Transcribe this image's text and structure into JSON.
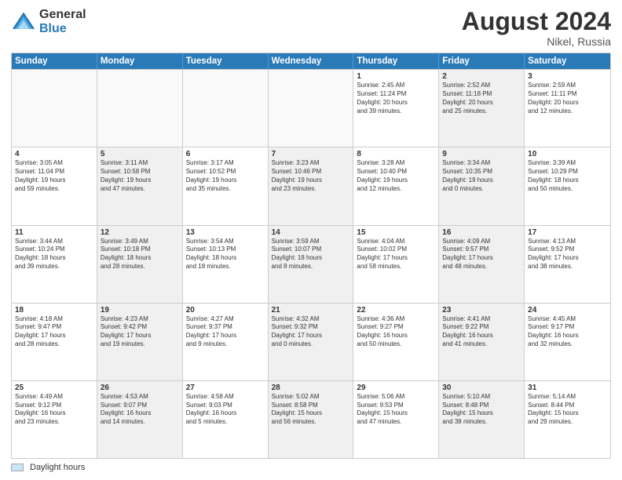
{
  "logo": {
    "general": "General",
    "blue": "Blue"
  },
  "title": "August 2024",
  "subtitle": "Nikel, Russia",
  "days_of_week": [
    "Sunday",
    "Monday",
    "Tuesday",
    "Wednesday",
    "Thursday",
    "Friday",
    "Saturday"
  ],
  "legend": "Daylight hours",
  "weeks": [
    [
      {
        "day": "",
        "info": "",
        "shaded": false,
        "empty": true
      },
      {
        "day": "",
        "info": "",
        "shaded": false,
        "empty": true
      },
      {
        "day": "",
        "info": "",
        "shaded": false,
        "empty": true
      },
      {
        "day": "",
        "info": "",
        "shaded": false,
        "empty": true
      },
      {
        "day": "1",
        "info": "Sunrise: 2:45 AM\nSunset: 11:24 PM\nDaylight: 20 hours\nand 39 minutes.",
        "shaded": false,
        "empty": false
      },
      {
        "day": "2",
        "info": "Sunrise: 2:52 AM\nSunset: 11:18 PM\nDaylight: 20 hours\nand 25 minutes.",
        "shaded": true,
        "empty": false
      },
      {
        "day": "3",
        "info": "Sunrise: 2:59 AM\nSunset: 11:11 PM\nDaylight: 20 hours\nand 12 minutes.",
        "shaded": false,
        "empty": false
      }
    ],
    [
      {
        "day": "4",
        "info": "Sunrise: 3:05 AM\nSunset: 11:04 PM\nDaylight: 19 hours\nand 59 minutes.",
        "shaded": false,
        "empty": false
      },
      {
        "day": "5",
        "info": "Sunrise: 3:11 AM\nSunset: 10:58 PM\nDaylight: 19 hours\nand 47 minutes.",
        "shaded": true,
        "empty": false
      },
      {
        "day": "6",
        "info": "Sunrise: 3:17 AM\nSunset: 10:52 PM\nDaylight: 19 hours\nand 35 minutes.",
        "shaded": false,
        "empty": false
      },
      {
        "day": "7",
        "info": "Sunrise: 3:23 AM\nSunset: 10:46 PM\nDaylight: 19 hours\nand 23 minutes.",
        "shaded": true,
        "empty": false
      },
      {
        "day": "8",
        "info": "Sunrise: 3:28 AM\nSunset: 10:40 PM\nDaylight: 19 hours\nand 12 minutes.",
        "shaded": false,
        "empty": false
      },
      {
        "day": "9",
        "info": "Sunrise: 3:34 AM\nSunset: 10:35 PM\nDaylight: 19 hours\nand 0 minutes.",
        "shaded": true,
        "empty": false
      },
      {
        "day": "10",
        "info": "Sunrise: 3:39 AM\nSunset: 10:29 PM\nDaylight: 18 hours\nand 50 minutes.",
        "shaded": false,
        "empty": false
      }
    ],
    [
      {
        "day": "11",
        "info": "Sunrise: 3:44 AM\nSunset: 10:24 PM\nDaylight: 18 hours\nand 39 minutes.",
        "shaded": false,
        "empty": false
      },
      {
        "day": "12",
        "info": "Sunrise: 3:49 AM\nSunset: 10:18 PM\nDaylight: 18 hours\nand 28 minutes.",
        "shaded": true,
        "empty": false
      },
      {
        "day": "13",
        "info": "Sunrise: 3:54 AM\nSunset: 10:13 PM\nDaylight: 18 hours\nand 18 minutes.",
        "shaded": false,
        "empty": false
      },
      {
        "day": "14",
        "info": "Sunrise: 3:59 AM\nSunset: 10:07 PM\nDaylight: 18 hours\nand 8 minutes.",
        "shaded": true,
        "empty": false
      },
      {
        "day": "15",
        "info": "Sunrise: 4:04 AM\nSunset: 10:02 PM\nDaylight: 17 hours\nand 58 minutes.",
        "shaded": false,
        "empty": false
      },
      {
        "day": "16",
        "info": "Sunrise: 4:09 AM\nSunset: 9:57 PM\nDaylight: 17 hours\nand 48 minutes.",
        "shaded": true,
        "empty": false
      },
      {
        "day": "17",
        "info": "Sunrise: 4:13 AM\nSunset: 9:52 PM\nDaylight: 17 hours\nand 38 minutes.",
        "shaded": false,
        "empty": false
      }
    ],
    [
      {
        "day": "18",
        "info": "Sunrise: 4:18 AM\nSunset: 9:47 PM\nDaylight: 17 hours\nand 28 minutes.",
        "shaded": false,
        "empty": false
      },
      {
        "day": "19",
        "info": "Sunrise: 4:23 AM\nSunset: 9:42 PM\nDaylight: 17 hours\nand 19 minutes.",
        "shaded": true,
        "empty": false
      },
      {
        "day": "20",
        "info": "Sunrise: 4:27 AM\nSunset: 9:37 PM\nDaylight: 17 hours\nand 9 minutes.",
        "shaded": false,
        "empty": false
      },
      {
        "day": "21",
        "info": "Sunrise: 4:32 AM\nSunset: 9:32 PM\nDaylight: 17 hours\nand 0 minutes.",
        "shaded": true,
        "empty": false
      },
      {
        "day": "22",
        "info": "Sunrise: 4:36 AM\nSunset: 9:27 PM\nDaylight: 16 hours\nand 50 minutes.",
        "shaded": false,
        "empty": false
      },
      {
        "day": "23",
        "info": "Sunrise: 4:41 AM\nSunset: 9:22 PM\nDaylight: 16 hours\nand 41 minutes.",
        "shaded": true,
        "empty": false
      },
      {
        "day": "24",
        "info": "Sunrise: 4:45 AM\nSunset: 9:17 PM\nDaylight: 16 hours\nand 32 minutes.",
        "shaded": false,
        "empty": false
      }
    ],
    [
      {
        "day": "25",
        "info": "Sunrise: 4:49 AM\nSunset: 9:12 PM\nDaylight: 16 hours\nand 23 minutes.",
        "shaded": false,
        "empty": false
      },
      {
        "day": "26",
        "info": "Sunrise: 4:53 AM\nSunset: 9:07 PM\nDaylight: 16 hours\nand 14 minutes.",
        "shaded": true,
        "empty": false
      },
      {
        "day": "27",
        "info": "Sunrise: 4:58 AM\nSunset: 9:03 PM\nDaylight: 16 hours\nand 5 minutes.",
        "shaded": false,
        "empty": false
      },
      {
        "day": "28",
        "info": "Sunrise: 5:02 AM\nSunset: 8:58 PM\nDaylight: 15 hours\nand 56 minutes.",
        "shaded": true,
        "empty": false
      },
      {
        "day": "29",
        "info": "Sunrise: 5:06 AM\nSunset: 8:53 PM\nDaylight: 15 hours\nand 47 minutes.",
        "shaded": false,
        "empty": false
      },
      {
        "day": "30",
        "info": "Sunrise: 5:10 AM\nSunset: 8:48 PM\nDaylight: 15 hours\nand 38 minutes.",
        "shaded": true,
        "empty": false
      },
      {
        "day": "31",
        "info": "Sunrise: 5:14 AM\nSunset: 8:44 PM\nDaylight: 15 hours\nand 29 minutes.",
        "shaded": false,
        "empty": false
      }
    ]
  ]
}
